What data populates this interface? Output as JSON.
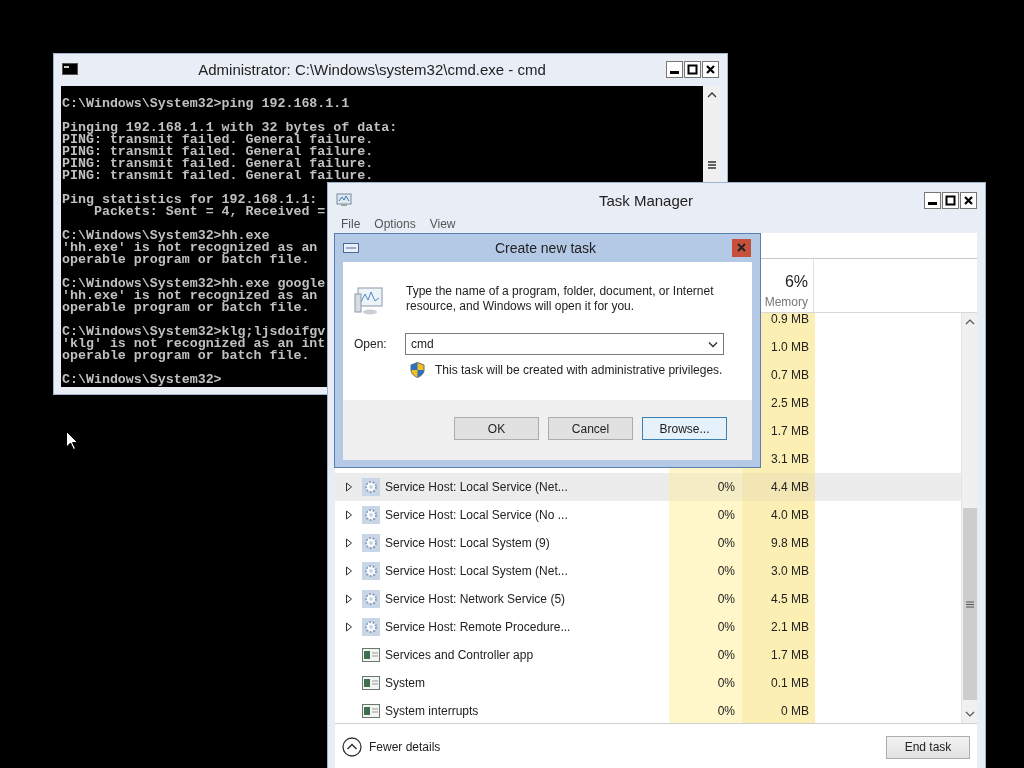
{
  "cmd_window": {
    "title": "Administrator: C:\\Windows\\system32\\cmd.exe - cmd",
    "blocks": [
      [
        "C:\\Windows\\System32>ping 192.168.1.1"
      ],
      [
        "Pinging 192.168.1.1 with 32 bytes of data:",
        "PING: transmit failed. General failure.",
        "PING: transmit failed. General failure.",
        "PING: transmit failed. General failure.",
        "PING: transmit failed. General failure."
      ],
      [
        "Ping statistics for 192.168.1.1:",
        "    Packets: Sent = 4, Received ="
      ],
      [
        "C:\\Windows\\System32>hh.exe",
        "'hh.exe' is not recognized as an",
        "operable program or batch file."
      ],
      [
        "C:\\Windows\\System32>hh.exe google",
        "'hh.exe' is not recognized as an",
        "operable program or batch file."
      ],
      [
        "C:\\Windows\\System32>klg;ljsdoifgv",
        "'klg' is not recognized as an int",
        "operable program or batch file."
      ],
      [
        "C:\\Windows\\System32>"
      ]
    ]
  },
  "task_manager": {
    "title": "Task Manager",
    "menu": [
      "File",
      "Options",
      "View"
    ],
    "memory_header": {
      "value": "6%",
      "label": "Memory"
    },
    "rows": [
      {
        "memory": "0.9 MB",
        "selected": false
      },
      {
        "memory": "1.0 MB",
        "selected": false
      },
      {
        "memory": "0.7 MB",
        "selected": false
      },
      {
        "memory": "2.5 MB",
        "selected": false
      },
      {
        "memory": "1.7 MB",
        "selected": false
      },
      {
        "memory": "3.1 MB",
        "selected": false
      },
      {
        "kind": "service",
        "name": "Service Host: Local Service (Net...",
        "cpu": "0%",
        "memory": "4.4 MB",
        "selected": true
      },
      {
        "kind": "service",
        "name": "Service Host: Local Service (No ...",
        "cpu": "0%",
        "memory": "4.0 MB",
        "selected": false
      },
      {
        "kind": "service",
        "name": "Service Host: Local System (9)",
        "cpu": "0%",
        "memory": "9.8 MB",
        "selected": false
      },
      {
        "kind": "service",
        "name": "Service Host: Local System (Net...",
        "cpu": "0%",
        "memory": "3.0 MB",
        "selected": false
      },
      {
        "kind": "service",
        "name": "Service Host: Network Service (5)",
        "cpu": "0%",
        "memory": "4.5 MB",
        "selected": false
      },
      {
        "kind": "service",
        "name": "Service Host: Remote Procedure...",
        "cpu": "0%",
        "memory": "2.1 MB",
        "selected": false
      },
      {
        "kind": "app",
        "name": "Services and Controller app",
        "cpu": "0%",
        "memory": "1.7 MB",
        "selected": false
      },
      {
        "kind": "app",
        "name": "System",
        "cpu": "0%",
        "memory": "0.1 MB",
        "selected": false
      },
      {
        "kind": "app",
        "name": "System interrupts",
        "cpu": "0%",
        "memory": "0 MB",
        "selected": false
      }
    ],
    "fewer_details": "Fewer details",
    "end_task": "End task"
  },
  "dialog": {
    "title": "Create new task",
    "message": "Type the name of a program, folder, document, or Internet resource, and Windows will open it for you.",
    "open_label": "Open:",
    "open_value": "cmd",
    "note": "This task will be created with administrative privileges.",
    "buttons": [
      {
        "label": "OK",
        "focused": false
      },
      {
        "label": "Cancel",
        "focused": false
      },
      {
        "label": "Browse...",
        "focused": true
      }
    ]
  }
}
